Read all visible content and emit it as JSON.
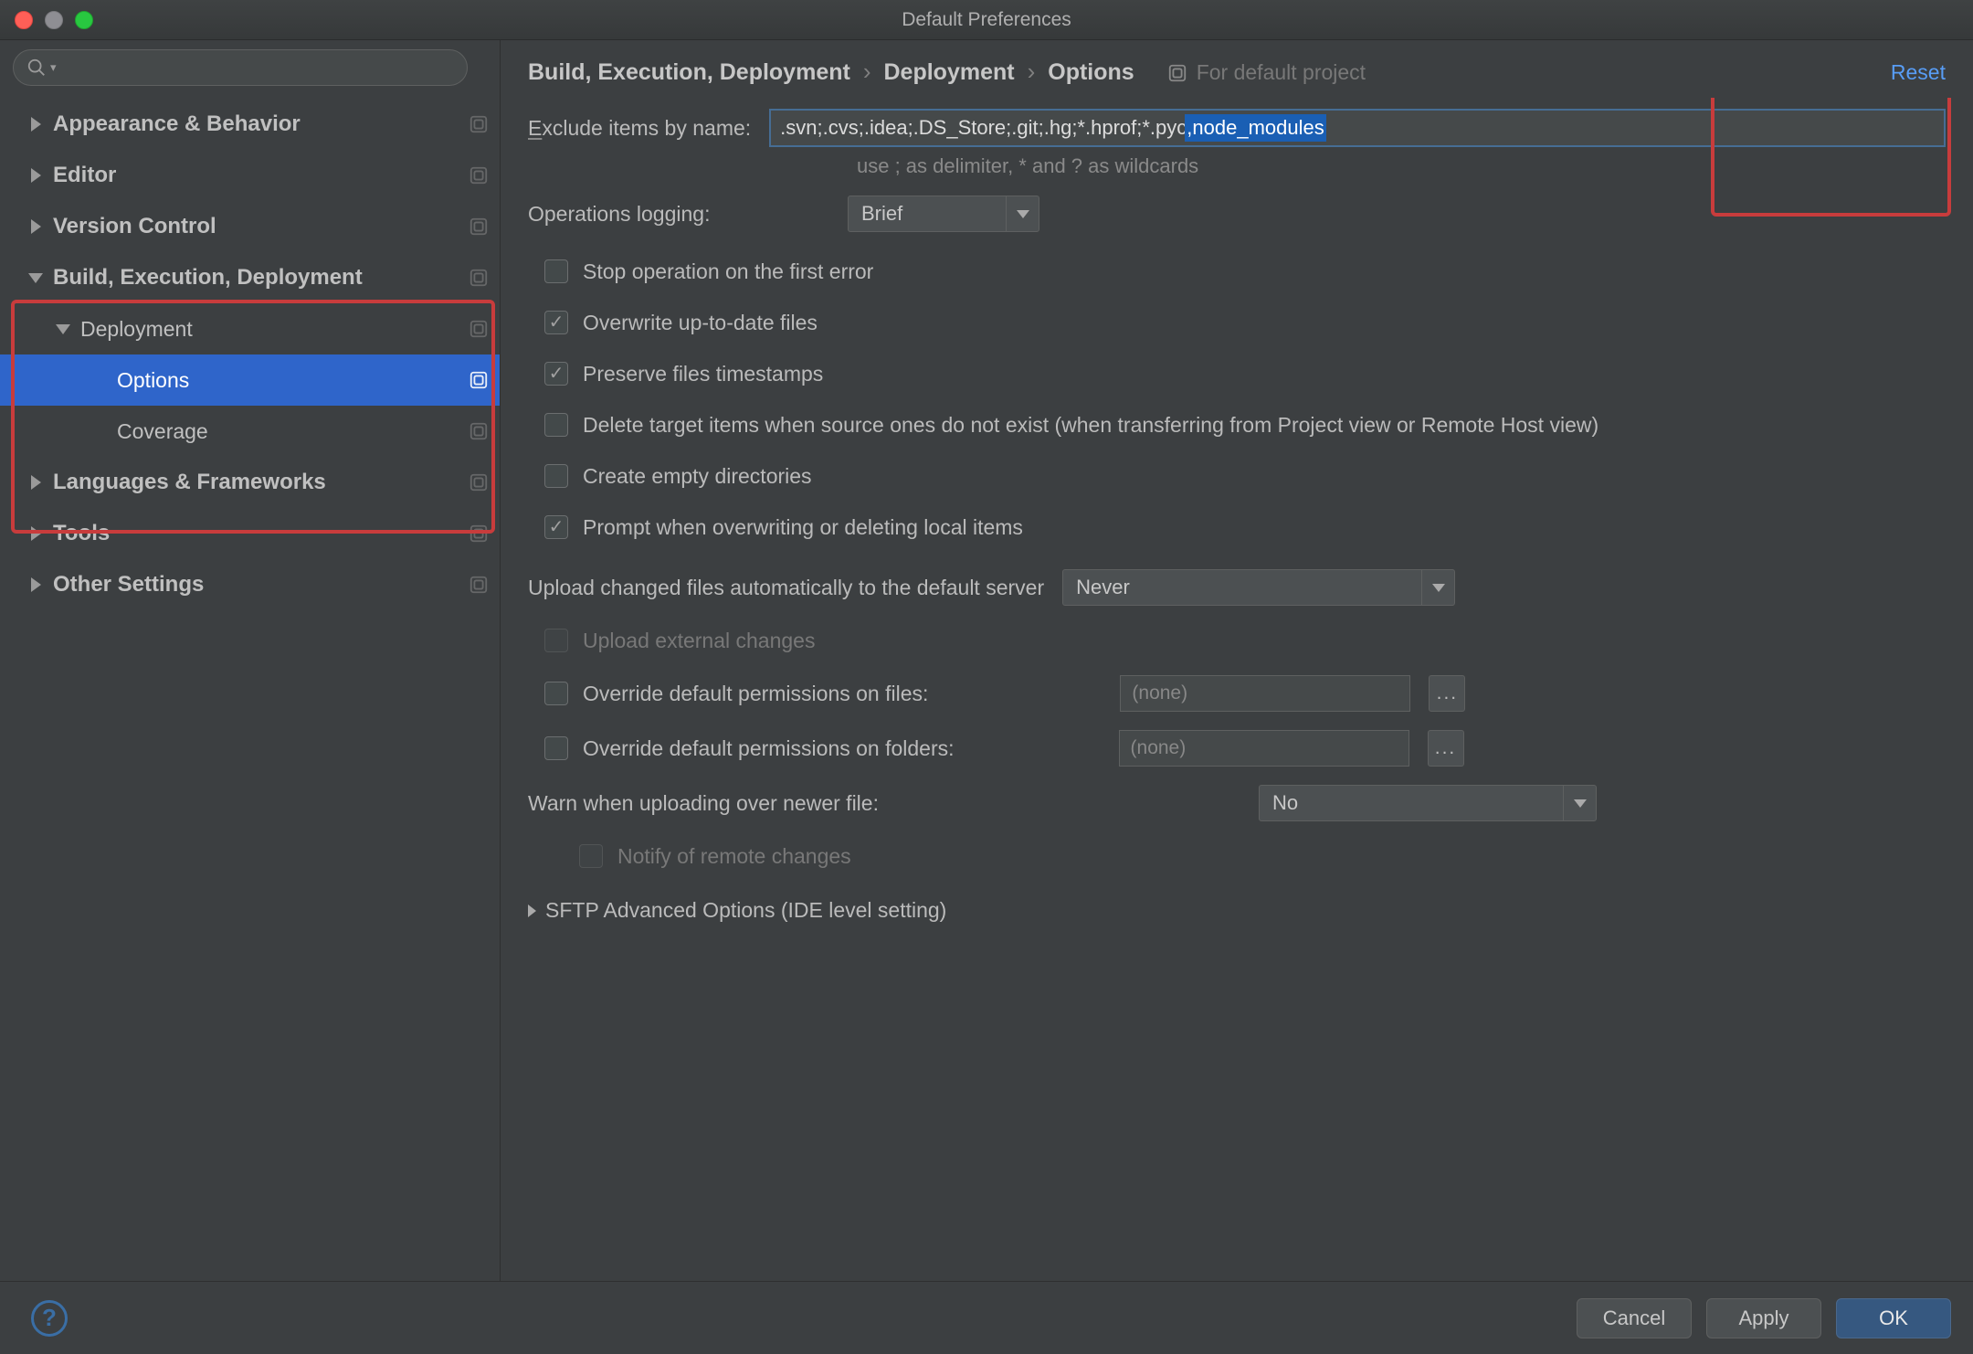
{
  "window": {
    "title": "Default Preferences"
  },
  "sidebar": {
    "search_placeholder": "",
    "items": [
      {
        "label": "Appearance & Behavior",
        "expanded": false,
        "depth": 0,
        "scope": true
      },
      {
        "label": "Editor",
        "expanded": false,
        "depth": 0,
        "scope": true
      },
      {
        "label": "Version Control",
        "expanded": false,
        "depth": 0,
        "scope": true
      },
      {
        "label": "Build, Execution, Deployment",
        "expanded": true,
        "depth": 0,
        "scope": true
      },
      {
        "label": "Deployment",
        "expanded": true,
        "depth": 1,
        "scope": true
      },
      {
        "label": "Options",
        "depth": 2,
        "selected": true,
        "scope": true
      },
      {
        "label": "Coverage",
        "depth": 2,
        "scope": true
      },
      {
        "label": "Languages & Frameworks",
        "expanded": false,
        "depth": 0,
        "scope": true
      },
      {
        "label": "Tools",
        "expanded": false,
        "depth": 0,
        "scope": true
      },
      {
        "label": "Other Settings",
        "expanded": false,
        "depth": 0,
        "scope": true
      }
    ]
  },
  "header": {
    "crumb1": "Build, Execution, Deployment",
    "crumb2": "Deployment",
    "crumb3": "Options",
    "for_default": "For default project",
    "reset": "Reset"
  },
  "form": {
    "exclude_label": "Exclude items by name:",
    "exclude_value_prefix": ".svn;.cvs;.idea;.DS_Store;.git;.hg;*.hprof;*.pyc",
    "exclude_value_selected": ",node_modules",
    "exclude_hint": "use ; as delimiter, * and ? as wildcards",
    "ops_logging_label": "Operations logging:",
    "ops_logging_value": "Brief",
    "cb_stop": "Stop operation on the first error",
    "cb_overwrite": "Overwrite up-to-date files",
    "cb_preserve": "Preserve files timestamps",
    "cb_delete": "Delete target items when source ones do not exist (when transferring from Project view or Remote Host view)",
    "cb_create": "Create empty directories",
    "cb_prompt": "Prompt when overwriting or deleting local items",
    "upload_auto_label": "Upload changed files automatically to the default server",
    "upload_auto_value": "Never",
    "cb_upload_ext": "Upload external changes",
    "cb_override_files": "Override default permissions on files:",
    "perm_files_value": "(none)",
    "cb_override_folders": "Override default permissions on folders:",
    "perm_folders_value": "(none)",
    "warn_label": "Warn when uploading over newer file:",
    "warn_value": "No",
    "cb_notify": "Notify of remote changes",
    "sftp_section": "SFTP Advanced Options (IDE level setting)",
    "ellipsis": "..."
  },
  "footer": {
    "cancel": "Cancel",
    "apply": "Apply",
    "ok": "OK",
    "help_tooltip": "?"
  }
}
